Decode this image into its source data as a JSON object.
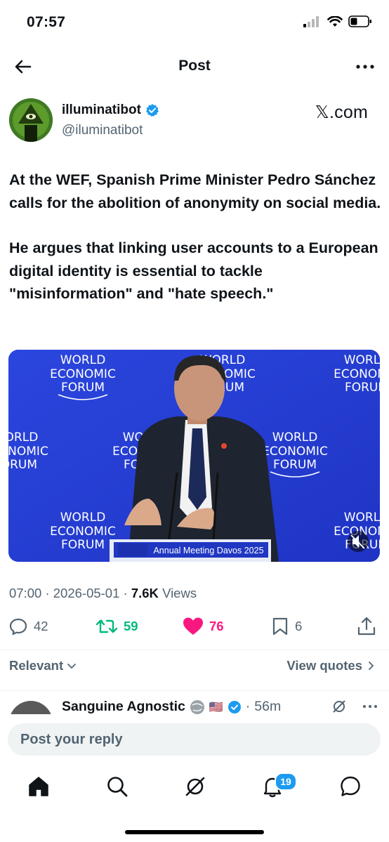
{
  "status_bar": {
    "time": "07:57"
  },
  "header": {
    "title": "Post"
  },
  "author": {
    "name": "illuminatibot",
    "handle": "@iluminatibot",
    "source": "𝕏.com"
  },
  "post": {
    "paragraphs": [
      "At the WEF, Spanish Prime Minister Pedro Sánchez calls for the abolition of anonymity on social media.",
      "He argues that linking user accounts to a European digital identity is essential to tackle \"misinformation\" and \"hate speech.\""
    ],
    "media": {
      "logo_word1": "WORLD",
      "logo_word2": "ECONOMIC",
      "logo_word3": "FORUM",
      "lectern_text": "Annual Meeting Davos 2025",
      "muted_icon": "speaker-muted-icon"
    },
    "time": "07:00",
    "date": "2026-05-01",
    "views_count": "7.6K",
    "views_label": "Views"
  },
  "actions": {
    "replies": "42",
    "reposts": "59",
    "likes": "76",
    "bookmarks": "6",
    "repost_color": "#00ba7c",
    "like_color": "#f91880"
  },
  "sort": {
    "label": "Relevant",
    "view_quotes": "View quotes"
  },
  "reply_preview": {
    "name": "Sanguine Agnostic",
    "time": "56m",
    "flag": "🇺🇸"
  },
  "compose": {
    "placeholder": "Post your reply"
  },
  "tab_bar": {
    "notifications_badge": "19"
  },
  "colors": {
    "accent": "#1d9bf0",
    "text": "#0f1419",
    "muted": "#536471"
  }
}
